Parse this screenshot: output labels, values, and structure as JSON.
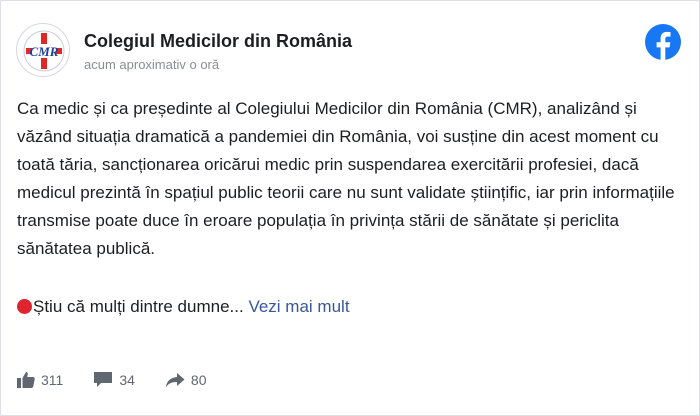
{
  "post": {
    "page_name": "Colegiul Medicilor din România",
    "timestamp": "acum aproximativ o oră",
    "body_text": "Ca medic și ca președinte al Colegiului Medicilor din România (CMR), analizând și văzând situația dramatică a pandemiei din România, voi susține din acest moment cu toată tăria, sancționarea oricărui medic prin suspendarea exercitării profesiei, dacă medicul prezintă în spațiul public teorii care nu sunt validate științific, iar prin informațiile transmise poate duce în eroare populația în privința stării de sănătate și periclita sănătatea publică.",
    "truncated_text": "Știu că mulți dintre dumne...",
    "see_more_label": "Vezi mai mult",
    "logo_text": "CMR"
  },
  "stats": {
    "likes": "311",
    "comments": "34",
    "shares": "80"
  },
  "colors": {
    "facebook_blue": "#1877f2",
    "link_blue": "#385898",
    "red_dot": "#e0242f",
    "icon_gray": "#606770"
  },
  "icons": [
    "cmr-logo",
    "facebook-icon",
    "red-circle-icon",
    "like-icon",
    "comment-icon",
    "share-icon"
  ]
}
